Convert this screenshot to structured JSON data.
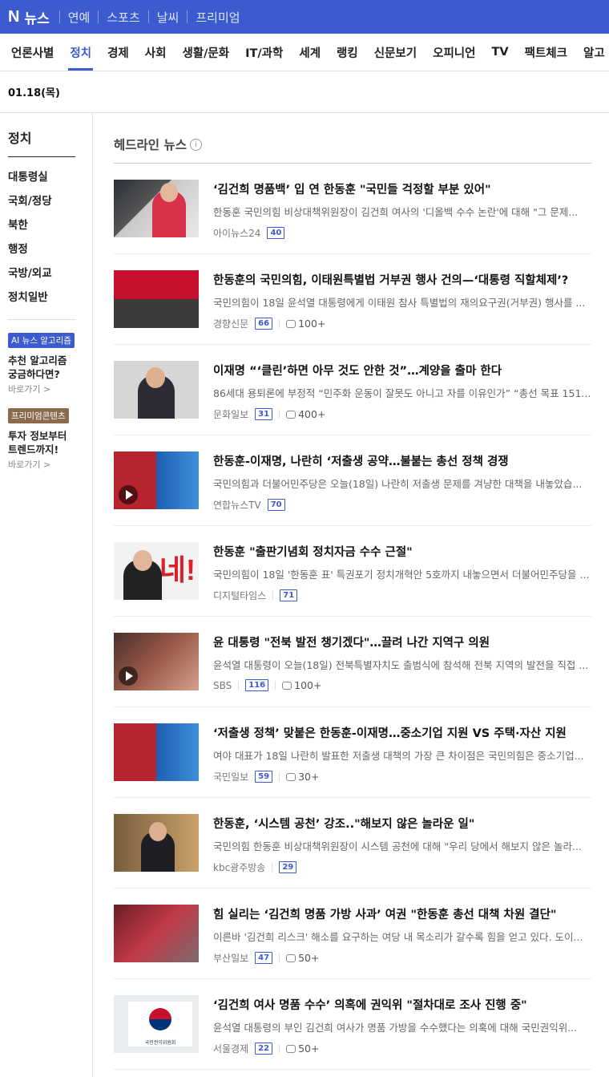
{
  "topbar": {
    "logo": "N",
    "brand": "뉴스",
    "services": [
      "연예",
      "스포츠",
      "날씨",
      "프리미엄"
    ]
  },
  "nav": {
    "tabs": [
      "언론사별",
      "정치",
      "경제",
      "사회",
      "생활/문화",
      "IT/과학",
      "세계",
      "랭킹",
      "신문보기",
      "오피니언",
      "TV",
      "팩트체크",
      "알고"
    ],
    "active": "정치"
  },
  "date": "01.18(목)",
  "sidebar": {
    "title": "정치",
    "items": [
      "대통령실",
      "국회/정당",
      "북한",
      "행정",
      "국방/외교",
      "정치일반"
    ],
    "promos": [
      {
        "badge": "AI 뉴스 알고리즘",
        "line1": "추천 알고리즘",
        "line2": "궁금하다면?",
        "link": "바로가기 >"
      },
      {
        "badge": "프리미엄콘텐츠",
        "line1": "투자 정보부터",
        "line2": "트렌드까지!",
        "link": "바로가기 >"
      }
    ]
  },
  "section": {
    "title": "헤드라인 뉴스",
    "info": "i"
  },
  "articles": [
    {
      "headline": "‘김건희 명품백’ 입 연 한동훈 \"국민들 걱정할 부분 있어\"",
      "summary": "한동훈 국민의힘 비상대책위원장이 김건희 여사의 '디올백 수수 논란'에 대해 \"그 문제...",
      "press": "아이뉴스24",
      "count": "40",
      "comments": ""
    },
    {
      "headline": "한동훈의 국민의힘, 이태원특별법 거부권 행사 건의—‘대통령 직할체제’?",
      "summary": "국민의힘이 18일 윤석열 대통령에게 이태원 참사 특별법의 재의요구권(거부권) 행사를 ...",
      "press": "경향신문",
      "count": "66",
      "comments": "100+"
    },
    {
      "headline": "이재명 “‘클린’하면 아무 것도 안한 것”…계양을 출마 한다",
      "summary": "86세대 용퇴론에 부정적 “민주화 운동이 잘못도 아니고 자를 이유인가” “총선 목표 151...",
      "press": "문화일보",
      "count": "31",
      "comments": "400+"
    },
    {
      "headline": "한동훈-이재명, 나란히 ‘저출생 공약…불붙는 총선 정책 경쟁",
      "summary": "국민의힘과 더불어민주당은 오늘(18일) 나란히 저출생 문제를 겨냥한 대책을 내놓았습...",
      "press": "연합뉴스TV",
      "count": "70",
      "comments": ""
    },
    {
      "headline": "한동훈 \"출판기념회 정치자금 수수 근절\"",
      "summary": "국민의힘이 18일 '한동훈 표' 특권포기 정치개혁안 5호까지 내놓으면서 더불어민주당을 ...",
      "press": "디지털타임스",
      "count": "71",
      "comments": ""
    },
    {
      "headline": "윤 대통령 \"전북 발전 챙기겠다\"…끌려 나간 지역구 의원",
      "summary": "윤석열 대통령이 오늘(18일) 전북특별자치도 출범식에 참석해 전북 지역의 발전을 직접 ...",
      "press": "SBS",
      "count": "116",
      "comments": "100+"
    },
    {
      "headline": "‘저출생 정책’ 맞붙은 한동훈-이재명…중소기업 지원 VS 주택·자산 지원",
      "summary": "여야 대표가 18일 나란히 발표한 저출생 대책의 가장 큰 차이점은 국민의힘은 중소기업...",
      "press": "국민일보",
      "count": "59",
      "comments": "30+"
    },
    {
      "headline": "한동훈, ‘시스템 공천’ 강조..\"해보지 않은 놀라운 일\"",
      "summary": "국민의힘 한동훈 비상대책위원장이 시스템 공천에 대해 \"우리 당에서 해보지 않은 놀라...",
      "press": "kbc광주방송",
      "count": "29",
      "comments": ""
    },
    {
      "headline": "힘 실리는 ‘김건희 명품 가방 사과’ 여권 \"한동훈 총선 대책 차원 결단\"",
      "summary": "이른바 '김건희 리스크' 해소를 요구하는 여당 내 목소리가 갈수록 힘을 얻고 있다. 도이...",
      "press": "부산일보",
      "count": "47",
      "comments": "50+"
    },
    {
      "headline": "‘김건희 여사 명품 수수’ 의혹에 권익위 \"절차대로 조사 진행 중\"",
      "summary": "윤석열 대통령의 부인 김건희 여사가 명품 가방을 수수했다는 의혹에 대해 국민권익위...",
      "press": "서울경제",
      "count": "22",
      "comments": "50+"
    }
  ],
  "thumb_sign": "국민권익위원회",
  "colors": {
    "brand": "#3b5bce",
    "badge_ai": "#3b5bce",
    "badge_premium": "#8a6b4e"
  }
}
